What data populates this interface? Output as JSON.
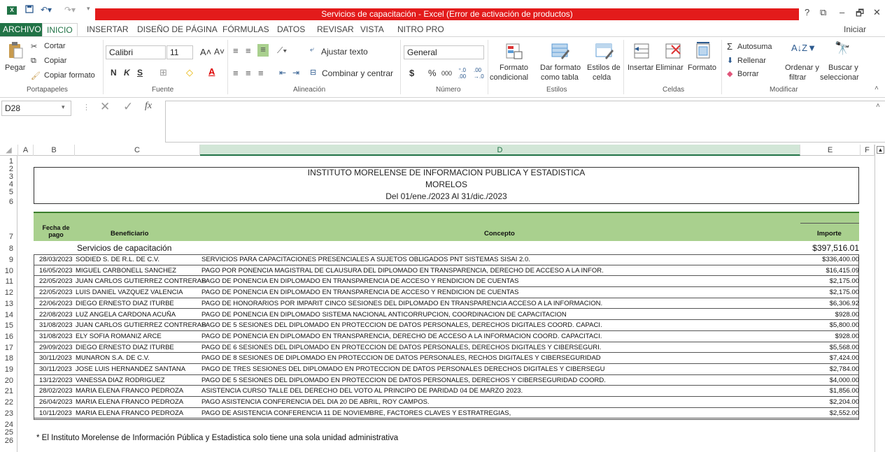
{
  "window": {
    "title": "Servicios de capacitación -  Excel (Error de activación de productos)",
    "controls": [
      "?",
      "⧉",
      "–",
      "🗗",
      "✕"
    ]
  },
  "tabs": [
    "ARCHIVO",
    "INICIO",
    "INSERTAR",
    "DISEÑO DE PÁGINA",
    "FÓRMULAS",
    "DATOS",
    "REVISAR",
    "VISTA",
    "NITRO PRO"
  ],
  "signin": "Iniciar sesión",
  "ribbon": {
    "clipboard": {
      "paste": "Pegar",
      "cut": "Cortar",
      "copy": "Copiar",
      "copy_format": "Copiar formato",
      "label": "Portapapeles"
    },
    "font": {
      "name": "Calibri",
      "size": "11",
      "label": "Fuente",
      "bold": "N",
      "italic": "K",
      "underline": "S"
    },
    "alignment": {
      "wrap": "Ajustar texto",
      "merge": "Combinar y centrar",
      "label": "Alineación"
    },
    "number": {
      "format": "General",
      "label": "Número",
      "currency": "$",
      "percent": "%",
      "thousands": "000"
    },
    "styles": {
      "conditional": "Formato",
      "conditional2": "condicional",
      "table": "Dar formato",
      "table2": "como tabla",
      "cell": "Estilos de",
      "cell2": "celda",
      "label": "Estilos"
    },
    "cells": {
      "insert": "Insertar",
      "delete": "Eliminar",
      "format": "Formato",
      "label": "Celdas"
    },
    "editing": {
      "autosum": "Autosuma",
      "fill": "Rellenar",
      "clear": "Borrar",
      "sort": "Ordenar y",
      "sort2": "filtrar",
      "find": "Buscar y",
      "find2": "seleccionar",
      "label": "Modificar"
    }
  },
  "formula_bar": {
    "name_box": "D28",
    "fx": "fx",
    "content": ""
  },
  "columns": [
    "A",
    "B",
    "C",
    "D",
    "E",
    "F"
  ],
  "rows": [
    "1",
    "2",
    "3",
    "4",
    "5",
    "6",
    "7",
    "8",
    "9",
    "10",
    "11",
    "12",
    "13",
    "14",
    "15",
    "16",
    "17",
    "18",
    "19",
    "20",
    "21",
    "22",
    "23",
    "24",
    "25",
    "26"
  ],
  "sheet": {
    "header1": "INSTITUTO MORELENSE DE INFORMACION PUBLICA Y ESTADISTICA",
    "header2": "MORELOS",
    "header3": "Del 01/ene./2023 Al 31/dic./2023",
    "col_fecha": "Fecha de pago",
    "col_beneficiario": "Beneficiario",
    "col_concepto": "Concepto",
    "col_importe": "Importe",
    "section_title": "Servicios de capacitación",
    "section_total": "$397,516.01",
    "footnote": "* El Instituto Morelense de Información Pública y Estadistica solo tiene una sola unidad administrativa",
    "records": [
      {
        "fecha": "28/03/2023",
        "beneficiario": "SODIED S. DE R.L. DE C.V.",
        "concepto": "SERVICIOS PARA CAPACITACIONES PRESENCIALES A SUJETOS OBLIGADOS PNT SISTEMAS SISAI 2.0.",
        "importe": "$336,400.00"
      },
      {
        "fecha": "16/05/2023",
        "beneficiario": "MIGUEL CARBONELL SANCHEZ",
        "concepto": "PAGO POR PONENCIA MAGISTRAL DE CLAUSURA DEL DIPLOMADO EN TRANSPARENCIA, DERECHO DE ACCESO A LA INFOR.",
        "importe": "$16,415.09"
      },
      {
        "fecha": "22/05/2023",
        "beneficiario": "JUAN CARLOS GUTIERREZ CONTRERAS",
        "concepto": "PAGO DE PONENCIA EN DIPLOMADO EN TRANSPARENCIA DE ACCESO Y RENDICION DE CUENTAS",
        "importe": "$2,175.00"
      },
      {
        "fecha": "22/05/2023",
        "beneficiario": "LUIS DANIEL VAZQUEZ VALENCIA",
        "concepto": "PAGO DE PONENCIA EN DIPLOMADO EN TRANSPARENCIA DE ACCESO Y RENDICION DE CUENTAS",
        "importe": "$2,175.00"
      },
      {
        "fecha": "22/06/2023",
        "beneficiario": "DIEGO ERNESTO DIAZ ITURBE",
        "concepto": "PAGO DE HONORARIOS POR IMPARIT CINCO SESIONES DEL DIPLOMADO EN TRANSPARENCIA ACCESO A LA INFORMACION.",
        "importe": "$6,306.92"
      },
      {
        "fecha": "22/08/2023",
        "beneficiario": "LUZ ANGELA CARDONA ACUÑA",
        "concepto": "PAGO DE PONENCIA EN DIPLOMADO SISTEMA NACIONAL ANTICORRUPCION, COORDINACION DE CAPACITACION",
        "importe": "$928.00"
      },
      {
        "fecha": "31/08/2023",
        "beneficiario": "JUAN CARLOS GUTIERREZ CONTRERAS",
        "concepto": "PAGO DE 5 SESIONES DEL DIPLOMADO EN PROTECCION DE DATOS PERSONALES, DERECHOS DIGITALES COORD. CAPACI.",
        "importe": "$5,800.00"
      },
      {
        "fecha": "31/08/2023",
        "beneficiario": "ELY SOFIA ROMANIZ ARCE",
        "concepto": "PAGO DE PONENCIA EN DIPLOMADO EN TRANSPARENCIA, DERECHO DE ACCESO A LA INFORMACION COORD. CAPACITACI.",
        "importe": "$928.00"
      },
      {
        "fecha": "29/09/2023",
        "beneficiario": "DIEGO ERNESTO DIAZ ITURBE",
        "concepto": "PAGO DE 6 SESIONES DEL DIPLOMADO EN PROTECCION DE DATOS PERSONALES, DERECHOS DIGITALES Y CIBERSEGURI.",
        "importe": "$5,568.00"
      },
      {
        "fecha": "30/11/2023",
        "beneficiario": "MUNARON S.A. DE C.V.",
        "concepto": "PAGO DE 8 SESIONES DE DIPLOMADO EN PROTECCION DE DATOS PERSONALES, RECHOS DIGITALES Y CIBERSEGURIDAD",
        "importe": "$7,424.00"
      },
      {
        "fecha": "30/11/2023",
        "beneficiario": "JOSE LUIS HERNANDEZ SANTANA",
        "concepto": "PAGO DE TRES SESIONES DEL DIPLOMADO EN PROTECCION DE DATOS PERSONALES DERECHOS DIGITALES Y CIBERSEGU",
        "importe": "$2,784.00"
      },
      {
        "fecha": "13/12/2023",
        "beneficiario": "VANESSA DIAZ RODRIGUEZ",
        "concepto": "PAGO DE 5 SESIONES DEL DIPLOMADO EN PROTECCION DE DATOS PERSONALES, DERECHOS Y CIBERSEGURIDAD COORD.",
        "importe": "$4,000.00"
      },
      {
        "fecha": "28/02/2023",
        "beneficiario": "MARIA ELENA FRANCO PEDROZA",
        "concepto": "ASISTENCIA CURSO TALLE DEL DERECHO DEL VOTO AL PRINCIPO DE PARIDAD 04 DE MARZO 2023.",
        "importe": "$1,856.00"
      },
      {
        "fecha": "26/04/2023",
        "beneficiario": "MARIA ELENA FRANCO PEDROZA",
        "concepto": "PAGO ASISTENCIA CONFERENCIA DEL DIA 20 DE ABRIL, ROY CAMPOS.",
        "importe": "$2,204.00"
      },
      {
        "fecha": "10/11/2023",
        "beneficiario": "MARIA ELENA FRANCO PEDROZA",
        "concepto": "PAGO DE ASISTENCIA CONFERENCIA 11 DE NOVIEMBRE, FACTORES CLAVES Y ESTRATREGIAS,",
        "importe": "$2,552.00"
      }
    ]
  },
  "colors": {
    "excel_green": "#217346",
    "title_red": "#e31b1b",
    "header_green": "#a9d08e"
  }
}
